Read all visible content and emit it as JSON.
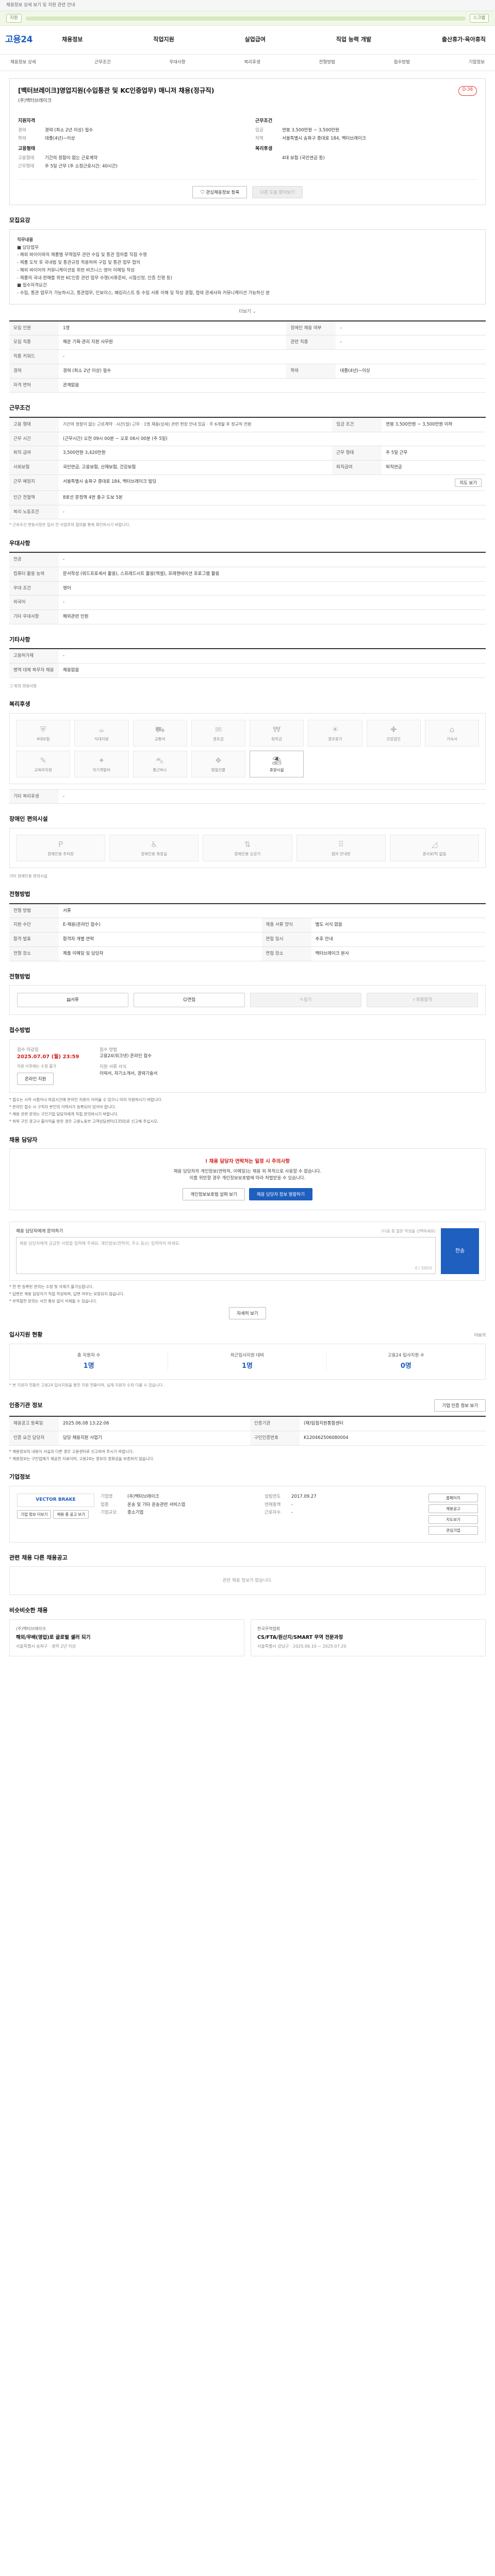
{
  "topbar": {
    "notice": "채용정보 상세 보기 및 지원 관련 안내"
  },
  "sticky": {
    "chip": "지원",
    "chip2": "스크랩"
  },
  "gnb": {
    "logo": "고용24",
    "menu": [
      "채용정보",
      "직업지원",
      "실업급여",
      "직업 능력 개발",
      "출산휴가·육아휴직"
    ]
  },
  "subnav": [
    "채용정보 상세",
    "근무조건",
    "우대사항",
    "복리후생",
    "전형방법",
    "접수방법",
    "기업정보"
  ],
  "job": {
    "title": "[백터브레이크]영업지원(수입통관 및 KC인증업무) 매니저 채용(정규직)",
    "dday": "D-38",
    "company": "(주)백터브레이크",
    "left_title": "지원자격",
    "left_rows": [
      {
        "k": "경력",
        "v": "경력 (최소 2년 이상) 필수"
      },
      {
        "k": "학력",
        "v": "대졸(4년)~이상"
      }
    ],
    "right_title": "근무조건",
    "right_rows": [
      {
        "k": "임금",
        "v": "연봉 3,500만원 ~ 3,500만원"
      },
      {
        "k": "지역",
        "v": "서울특별시 송파구 중대로 184, 백터브레이크"
      }
    ],
    "left_title2": "고용형태",
    "left_rows2": [
      {
        "k": "고용형태",
        "v": "기간의 정함이 없는 근로계약"
      },
      {
        "k": "근무형태",
        "v": "주 5일 근무 (주 소정근로시간: 40시간)"
      }
    ],
    "right_title2": "복리후생",
    "right_rows2": [
      {
        "k": "",
        "v": "4대 보험 (국민연금 등)"
      }
    ],
    "btn_scrap": "관심채용정보 등록",
    "btn_share": "다른 도움 찾아보기"
  },
  "recruit": {
    "heading": "모집요강",
    "box_title": "직무내용",
    "lines": [
      "■ 담당업무",
      "- 해외 바이어와의 제품별 무역업무 관련 수입 및 통관 절차를 직접 수행",
      "- 제품 도착 후 국내법 및 통관규정 적용하여 구입 및 통관 업무 협의",
      "- 해외 바이어의 커뮤니케이션을 위한 비즈니스 영어 이메일 작성",
      "- 제품의 국내 판매를 위한 KC인증 관련 업무 수행(서류준비, 시험신청, 인증 진행 등)",
      "■ 필수자격요건",
      "- 수입, 통관 업무가 가능하시고, 통관업무, 인보이스, 패킹리스트 등 수입 서류 이해 및 작성 경험, 협력 관세사와 커뮤니케이션 가능하신 분"
    ],
    "more": "더보기",
    "rows": [
      {
        "k1": "모집 인원",
        "v1": "1명",
        "k2": "장애인 채용 여부",
        "v2": "-"
      },
      {
        "k1": "모집 직종",
        "v1": "해운 기획·관리 지원 사무원",
        "k2": "관련 직종",
        "v2": "-"
      },
      {
        "k1": "직종 키워드",
        "v1": "-",
        "k2": "",
        "v2": ""
      },
      {
        "k1": "경력",
        "v1": "경력 (최소 2년 이상) 필수",
        "k2": "학력",
        "v2": "대졸(4년)~이상"
      },
      {
        "k1": "자격 면허",
        "v1": "관계없음",
        "k2": "",
        "v2": ""
      }
    ]
  },
  "conditions": {
    "heading": "근무조건",
    "rows": [
      {
        "k1": "고용 형태",
        "v1": "기간의 정함이 없는 근로계약 · 시간(일) 근무 · 1명 채용(상세) 관련 현장 안내 있음 · 주 6개월 후 정규직 전환",
        "k2": "임금 조건",
        "v2": "연봉 3,500만원 ~ 3,500만원 이하"
      },
      {
        "k1": "근무 시간",
        "v1": "(근무시간) 오전 09시 00분 ~ 오후 06시 00분 (주 5일)",
        "k2": "",
        "v2": ""
      },
      {
        "k1": "퇴직 급여",
        "v1": "3,500만원 3,420만원",
        "k2": "근무 형태",
        "v2": "주 5일 근무"
      },
      {
        "k1": "사회보험",
        "v1": "국민연금, 고용보험, 산재보험, 건강보험",
        "k2": "퇴직급여",
        "v2": "퇴직연금"
      },
      {
        "k1": "근무 예정지",
        "v1": "서울특별시 송파구 중대로 184, 백터브레이크 빌딩",
        "k2": "",
        "v2": ""
      },
      {
        "k1": "인근 전철역",
        "v1": "8호선 문정역 4번 출구 도보 5분",
        "k2": "",
        "v2": ""
      },
      {
        "k1": "복리 노동조건",
        "v1": "-",
        "k2": "",
        "v2": ""
      }
    ],
    "map_btn": "지도 보기",
    "note": "* 근로조건 변동사항은 입사 전 사업주와 협의를 통해 확인하시기 바랍니다."
  },
  "prefer": {
    "heading": "우대사항",
    "rows": [
      {
        "k": "전공",
        "v": "-"
      },
      {
        "k": "컴퓨터 활용 능력",
        "v": "문서작성 (워드프로세서 활용), 스프레드시트 활용(엑셀), 프레젠테이션 프로그램 활용"
      },
      {
        "k": "우대 조건",
        "v": "영어"
      },
      {
        "k": "외국어",
        "v": "-"
      },
      {
        "k": "기타 우대사항",
        "v": "해외관련 민원"
      }
    ]
  },
  "other": {
    "heading": "기타사항",
    "rows": [
      {
        "k": "고용허가제",
        "v": "-"
      },
      {
        "k": "병역 대체 복무자 채용",
        "v": "채용없음"
      }
    ],
    "link": "그 밖의 회원사항"
  },
  "welfare": {
    "heading": "복리후생",
    "icons": [
      "4대보험",
      "식대지원",
      "교통비",
      "경조금",
      "퇴직금",
      "경조휴가",
      "건강검진",
      "기숙사",
      "교육비지원",
      "자기계발비",
      "통근버스",
      "명절선물",
      "휴양시설"
    ],
    "active": [
      12
    ],
    "note_label": "기타 복리후생",
    "note": "-"
  },
  "disability": {
    "heading": "장애인 편의시설",
    "icons": [
      "장애인용 주차장",
      "장애인용 화장실",
      "장애인용 승강기",
      "점자 안내판",
      "경사로/턱 없음"
    ],
    "note": "기타 장애인용 편의시설"
  },
  "selection": {
    "heading": "전형방법",
    "rows": [
      {
        "k1": "전형 방법",
        "v1": "서류",
        "k2": "",
        "v2": ""
      },
      {
        "k1": "지원 수단",
        "v1": "E-채용(온라인 접수)",
        "k2": "제출 서류 양식",
        "v2": "별도 서식 없음"
      },
      {
        "k1": "합격 발표",
        "v1": "합격자 개별 연락",
        "k2": "면접 일시",
        "v2": "추후 안내"
      },
      {
        "k1": "전형 장소",
        "v1": "제출 이메일 및 담당자",
        "k2": "면접 장소",
        "v2": "백터브레이크 본사"
      }
    ]
  },
  "process": {
    "heading": "전형방법",
    "steps": [
      "서류",
      "면접",
      "필기",
      "최종합격"
    ],
    "disabled": [
      2,
      3
    ]
  },
  "apply": {
    "heading": "접수방법",
    "deadline_label": "접수 마감일",
    "deadline": "2025.07.07 (월) 23:59",
    "deadline_note": "지원 이후에는 수정 불가",
    "method_label": "접수 방법",
    "method": "고용24(워크넷) 온라인 접수",
    "apply_btn": "온라인 지원",
    "form_label": "지원 서류 서식",
    "form": "이력서, 자기소개서, 경력기술서",
    "bullets": [
      "* 접수는 시작 시점이나 마감시간에 온라인 지원이 어려울 수 있으니 미리 지원하시기 바랍니다.",
      "* 온라인 접수 시 구직자 본인의 이력서가 등록되어 있어야 합니다.",
      "* 채용 관련 문의는 구인기업 담당자에게 직접 문의하시기 바랍니다.",
      "* 허위 구인 광고나 불이익을 받은 경우 고용노동부 고객상담센터(1350)로 신고해 주십시오."
    ]
  },
  "manager": {
    "heading": "채용 담당자",
    "warn": "! 채용 담당자 연락처는 일정 시 주의사항",
    "text1": "채용 담당자의 개인정보(연락처, 이메일)는 채용 외 목적으로 사용할 수 없습니다.",
    "text2": "이를 위반할 경우 개인정보보호법에 따라 처벌받을 수 있습니다.",
    "btn1": "개인정보보호법 살펴 보기",
    "btn2": "채용 담당자 정보 열람하기"
  },
  "qna": {
    "label": "채용 담당자에게 문의하기",
    "sub": "(다음 중 질문 작성을 선택하세요)",
    "placeholder": "채용 담당자에게 궁금한 사항을 입력해 주세요. 개인정보(연락처, 주소 등)는 입력하지 마세요.",
    "count": "0 / 500자",
    "send": "전송",
    "notes": [
      "* 한 번 등록된 문의는 수정 및 삭제가 불가능합니다.",
      "* 답변은 채용 담당자가 직접 작성하며, 답변 여부는 보장되지 않습니다.",
      "* 부적절한 문의는 사전 통보 없이 삭제될 수 있습니다."
    ],
    "more_btn": "자세히 보기"
  },
  "status": {
    "heading": "입사지원 현황",
    "more": "더보기",
    "items": [
      {
        "label": "총 지원자 수",
        "value": "1명"
      },
      {
        "label": "최근입사지원 대비",
        "value": "1명"
      },
      {
        "label": "고용24 입사지원 수",
        "value": "0명"
      }
    ],
    "note": "* 본 지원자 현황은 고용24 입사지원을 통한 지원 현황이며, 실제 지원자 수와 다를 수 있습니다."
  },
  "info": {
    "heading": "인증기관 정보",
    "link": "기업 인증 정보 보기",
    "rows": [
      {
        "k1": "채용공고 등록일",
        "v1": "2025.06.08 13:22:06",
        "k2": "인증기관",
        "v2": "(재)입점지원통합센터"
      },
      {
        "k1": "인증 요건 담당자",
        "v1": "담당 채용지원 사업기",
        "k2": "구인인증번호",
        "v2": "K120462506080004"
      }
    ],
    "notes": [
      "* 채용정보의 내용이 사실과 다른 경우 고용센터로 신고하여 주시기 바랍니다.",
      "* 채용정보는 구인업체가 제공한 자료이며, 고용24는 정보의 정확성을 보증하지 않습니다."
    ]
  },
  "corp": {
    "heading": "기업정보",
    "logo": "VECTOR BRAKE",
    "btn1": "기업 정보 더보기",
    "btn2": "채용 중 공고 보기",
    "rows_left": [
      {
        "k": "기업명",
        "v": "(주)백터브레이크"
      },
      {
        "k": "업종",
        "v": "운송 및 기타 운송관련 서비스업"
      },
      {
        "k": "기업규모",
        "v": "중소기업"
      }
    ],
    "rows_right": [
      {
        "k": "설립연도",
        "v": "2017.09.27"
      },
      {
        "k": "연매출액",
        "v": "-"
      },
      {
        "k": "근로자수",
        "v": "-"
      }
    ],
    "side": [
      "홈페이지",
      "채용공고",
      "지도보기",
      "관심기업"
    ]
  },
  "similar": {
    "heading": "관련 채용 다른 채용공고",
    "empty": "관련 채용 정보가 없습니다."
  },
  "related": {
    "heading": "비슷비슷한 채용",
    "cards": [
      {
        "company": "(주)백터브레이크",
        "title": "해외/무배(영업)로 글로벌 셀러 되기",
        "meta": "서울특별시 송파구 · 경력 2년 이상"
      },
      {
        "company": "한국무역협회",
        "title": "CS/FTA/원산지/SMART 무역 전문과정",
        "meta": "서울특별시 강남구 · 2025.06.10 ~ 2025.07.20"
      }
    ]
  }
}
